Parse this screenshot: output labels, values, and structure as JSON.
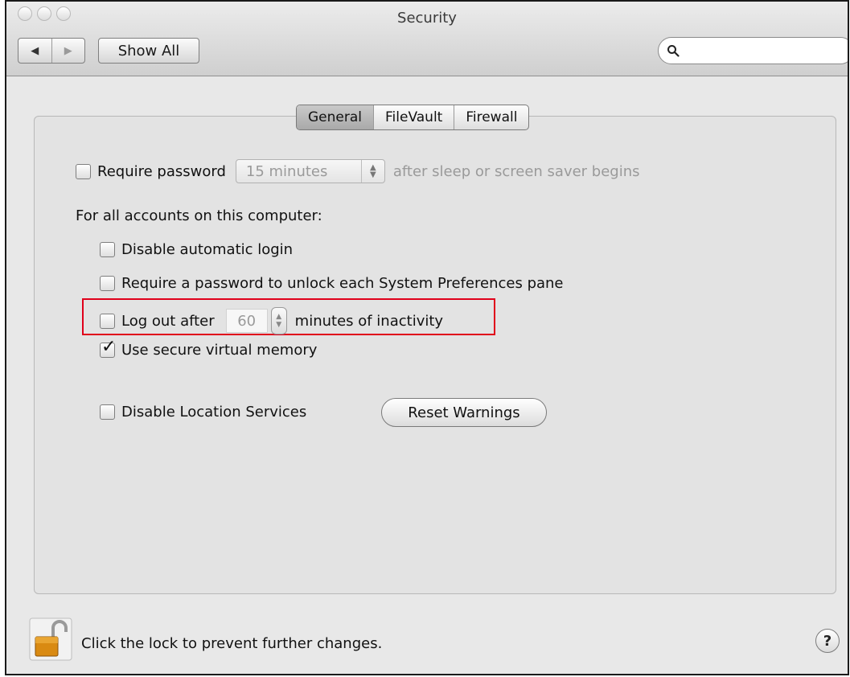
{
  "window": {
    "title": "Security",
    "nav": {
      "back_glyph": "◀",
      "forward_glyph": "▶"
    },
    "show_all_label": "Show All",
    "search": {
      "placeholder": "",
      "value": ""
    }
  },
  "tabs": [
    {
      "label": "General",
      "active": true
    },
    {
      "label": "FileVault",
      "active": false
    },
    {
      "label": "Firewall",
      "active": false
    }
  ],
  "general": {
    "require_password": {
      "label": "Require password",
      "checked": false,
      "popup_value": "15 minutes",
      "suffix": "after sleep or screen saver begins"
    },
    "accounts_heading": "For all accounts on this computer:",
    "options": [
      {
        "label": "Disable automatic login",
        "checked": false
      },
      {
        "label": "Require a password to unlock each System Preferences pane",
        "checked": false
      }
    ],
    "logout": {
      "label": "Log out after",
      "checked": false,
      "minutes": "60",
      "suffix": "minutes of inactivity",
      "highlighted": true
    },
    "secure_vm": {
      "label": "Use secure virtual memory",
      "checked": true
    },
    "location": {
      "label": "Disable Location Services",
      "checked": false
    },
    "reset_warnings_label": "Reset Warnings"
  },
  "footer": {
    "lock_text": "Click the lock to prevent further changes.",
    "help_glyph": "?"
  },
  "colors": {
    "highlight_box": "#e0001b",
    "active_tab": "#b5b5b5",
    "window_bg": "#e8e8e8"
  }
}
